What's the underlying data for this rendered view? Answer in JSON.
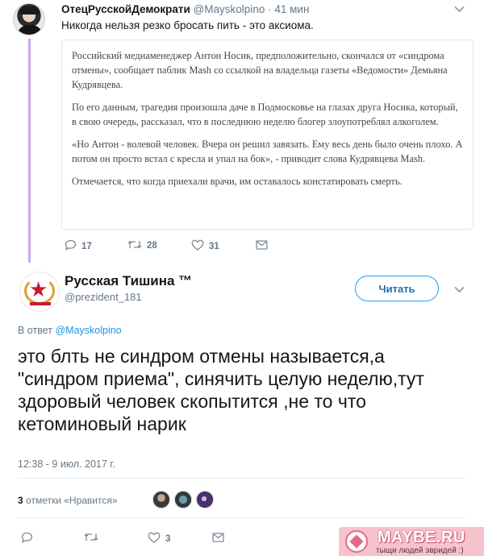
{
  "parent_tweet": {
    "display_name": "ОтецРусскойДемократи",
    "handle": "@Mayskolpino",
    "separator": "·",
    "time": "41 мин",
    "text": "Никогда нельзя резко бросать пить - это аксиома.",
    "quote_paragraphs": [
      "Российский медиаменеджер Антон Носик, предположительно, скончался от «синдрома отмены», сообщает паблик Mash со ссылкой на владельца газеты «Ведомости» Демьяна Кудрявцева.",
      "По его данным, трагедия произошла даче в Подмосковье на глазах друга Носика, который, в свою очередь, рассказал, что в последнюю неделю блогер злоупотреблял алкоголем.",
      "«Но Антон - волевой человек. Вчера он решил завязать. Ему весь день было очень плохо. А потом он просто встал с кресла и упал на бок», - приводит слова Кудрявцева Mash.",
      "Отмечается, что когда приехали врачи, им оставалось констатировать смерть."
    ],
    "actions": {
      "replies": "17",
      "retweets": "28",
      "likes": "31"
    }
  },
  "main_tweet": {
    "display_name": "Русская Тишина ™",
    "handle": "@prezident_181",
    "follow_label": "Читать",
    "reply_prefix": "В ответ",
    "reply_handle": "@Mayskolpino",
    "text": "это блть не синдром отмены называется,а \"синдром приема\", синячить целую неделю,тут здоровый человек скопытится ,не то что кетоминовый нарик",
    "timestamp": "12:38 - 9 июл. 2017 г.",
    "likes_count": "3",
    "likes_label": "отметки «Нравится»",
    "actions": {
      "likes": "3"
    }
  },
  "watermark": {
    "title": "MAYBE.RU",
    "subtitle": "тыщи людей эвридей :)"
  },
  "icons": {
    "reply": "reply-icon",
    "retweet": "retweet-icon",
    "like": "heart-icon",
    "dm": "envelope-icon",
    "more": "chevron-down-icon"
  },
  "colors": {
    "accent": "#1da1f2",
    "thread_line": "#c9a9e8",
    "secondary_text": "#657786"
  }
}
